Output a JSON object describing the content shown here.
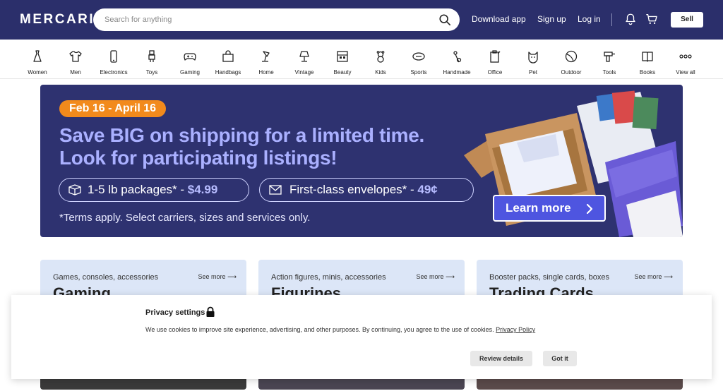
{
  "header": {
    "logo": "MERCARI",
    "search_placeholder": "Search for anything",
    "download": "Download app",
    "signup": "Sign up",
    "login": "Log in",
    "sell": "Sell"
  },
  "categories": [
    {
      "label": "Women",
      "icon": "dress-icon"
    },
    {
      "label": "Men",
      "icon": "tshirt-icon"
    },
    {
      "label": "Electronics",
      "icon": "phone-icon"
    },
    {
      "label": "Toys",
      "icon": "robot-icon"
    },
    {
      "label": "Gaming",
      "icon": "gamepad-icon"
    },
    {
      "label": "Handbags",
      "icon": "handbag-icon"
    },
    {
      "label": "Home",
      "icon": "lamp-icon"
    },
    {
      "label": "Vintage",
      "icon": "vintage-lamp-icon"
    },
    {
      "label": "Beauty",
      "icon": "palette-icon"
    },
    {
      "label": "Kids",
      "icon": "teddy-icon"
    },
    {
      "label": "Sports",
      "icon": "football-icon"
    },
    {
      "label": "Handmade",
      "icon": "needle-icon"
    },
    {
      "label": "Office",
      "icon": "clipboard-icon"
    },
    {
      "label": "Pet",
      "icon": "cat-icon"
    },
    {
      "label": "Outdoor",
      "icon": "ball-icon"
    },
    {
      "label": "Tools",
      "icon": "drill-icon"
    },
    {
      "label": "Books",
      "icon": "book-icon"
    },
    {
      "label": "View all",
      "icon": "more-icon"
    }
  ],
  "banner": {
    "date": "Feb 16 - April 16",
    "headline_1": "Save BIG on shipping for a limited time.",
    "headline_2": "Look for participating listings!",
    "packages_text": "1-5 lb packages* - ",
    "packages_price": "$4.99",
    "envelopes_text": "First-class envelopes* - ",
    "envelopes_price": "49¢",
    "terms": "*Terms apply. Select carriers, sizes and services only.",
    "cta": "Learn more"
  },
  "cards": [
    {
      "sub": "Games, consoles, accessories",
      "title": "Gaming",
      "see": "See more"
    },
    {
      "sub": "Action figures, minis, accessories",
      "title": "Figurines",
      "see": "See more"
    },
    {
      "sub": "Booster packs, single cards, boxes",
      "title": "Trading Cards",
      "see": "See more"
    }
  ],
  "privacy": {
    "title": "Privacy settings",
    "text": "We use cookies to improve site experience, advertising, and other purposes. By continuing, you agree to the use of cookies.",
    "link": "Privacy Policy",
    "review": "Review details",
    "got_it": "Got it"
  },
  "colors": {
    "header_bg": "#2b2f6b",
    "banner_bg": "#2e3270",
    "accent_orange": "#f28a1c",
    "cta_blue": "#4e55e0",
    "card_bg": "#dce6f7"
  }
}
